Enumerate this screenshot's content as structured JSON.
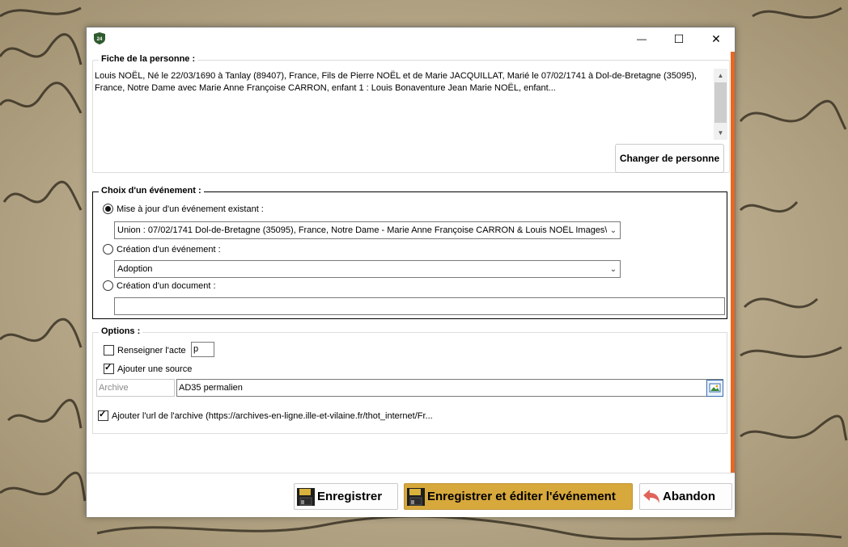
{
  "window": {
    "app_icon_text": "24",
    "minimize_glyph": "—",
    "maximize_glyph": "☐",
    "close_glyph": "✕"
  },
  "person": {
    "title": "Fiche de la personne :",
    "text": "Louis NOËL, Né le 22/03/1690 à Tanlay (89407), France, Fils de Pierre NOËL et de Marie JACQUILLAT, Marié le 07/02/1741 à Dol-de-Bretagne (35095), France, Notre Dame avec Marie Anne Françoise CARRON, enfant 1 : Louis Bonaventure Jean Marie NOËL, enfant...",
    "change_button": "Changer de personne"
  },
  "event": {
    "title": "Choix d'un événement :",
    "option_update_label": "Mise à jour d'un événement existant :",
    "option_update_selected": true,
    "existing_event_value": "Union : 07/02/1741 Dol-de-Bretagne (35095), France, Notre Dame - Marie Anne Françoise CARRON & Louis NOËL Images\\NOI",
    "option_create_label": "Création d'un événement :",
    "new_event_value": "Adoption",
    "option_document_label": "Création d'un document :",
    "document_value": ""
  },
  "options": {
    "title": "Options :",
    "fill_act_label": "Renseigner l'acte",
    "fill_act_checked": false,
    "fill_act_value": "p",
    "add_source_label": "Ajouter une source",
    "add_source_checked": true,
    "archive_placeholder": "Archive",
    "source_value": "AD35 permalien",
    "add_url_label": "Ajouter l'url de l'archive (https://archives-en-ligne.ille-et-vilaine.fr/thot_internet/Fr...",
    "add_url_checked": true
  },
  "footer": {
    "save_label": "Enregistrer",
    "save_edit_label": "Enregistrer et éditer l'événement",
    "cancel_label": "Abandon"
  },
  "colors": {
    "accent": "#e7681f",
    "primary_button": "#d7a83c",
    "cancel_arrow": "#e0645a"
  }
}
